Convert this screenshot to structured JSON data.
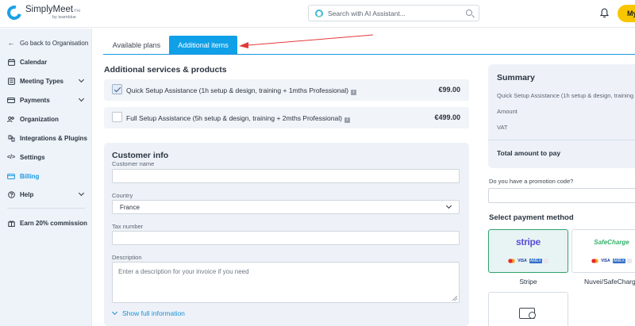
{
  "header": {
    "logo_name": "SimplyMeet",
    "logo_suffix": "me",
    "logo_by": "by teamblue",
    "search_placeholder": "Search with AI Assistant...",
    "account_button": "My"
  },
  "sidebar": {
    "back": "Go back to Organisation",
    "items": [
      {
        "label": "Calendar"
      },
      {
        "label": "Meeting Types"
      },
      {
        "label": "Payments"
      },
      {
        "label": "Organization"
      },
      {
        "label": "Integrations & Plugins"
      },
      {
        "label": "Settings"
      },
      {
        "label": "Billing"
      },
      {
        "label": "Help"
      }
    ],
    "earn": "Earn 20% commission"
  },
  "tabs": {
    "available": "Available plans",
    "additional": "Additional items"
  },
  "services": {
    "title": "Additional services & products",
    "items": [
      {
        "label": "Quick Setup Assistance (1h setup & design, training + 1mths Professional)",
        "price": "€99.00",
        "checked": true
      },
      {
        "label": "Full Setup Assistance (5h setup & design, training + 2mths Professional)",
        "price": "€499.00",
        "checked": false
      }
    ],
    "info_glyph": "i"
  },
  "customer": {
    "title": "Customer info",
    "name_label": "Customer name",
    "name_value": "",
    "country_label": "Country",
    "country_value": "France",
    "tax_label": "Tax number",
    "tax_value": "",
    "description_label": "Description",
    "description_placeholder": "Enter a description for your invoice if you need",
    "show_full": "Show full information"
  },
  "summary": {
    "title": "Summary",
    "item": "Quick Setup Assistance (1h setup & design, training +",
    "amount": "Amount",
    "vat": "VAT",
    "total": "Total amount to pay"
  },
  "promo": {
    "label": "Do you have a promotion code?"
  },
  "payment": {
    "title": "Select payment method",
    "methods": [
      {
        "logo": "stripe",
        "name": "Stripe",
        "selected": true
      },
      {
        "logo": "SafeCharge",
        "name": "Nuvei/SafeCharg",
        "selected": false
      }
    ],
    "card_brands": [
      "VISA",
      "AMEX"
    ]
  },
  "colors": {
    "accent": "#0fa0e8",
    "brand_yellow": "#f7c600",
    "annotation_arrow": "#e23a3a"
  }
}
